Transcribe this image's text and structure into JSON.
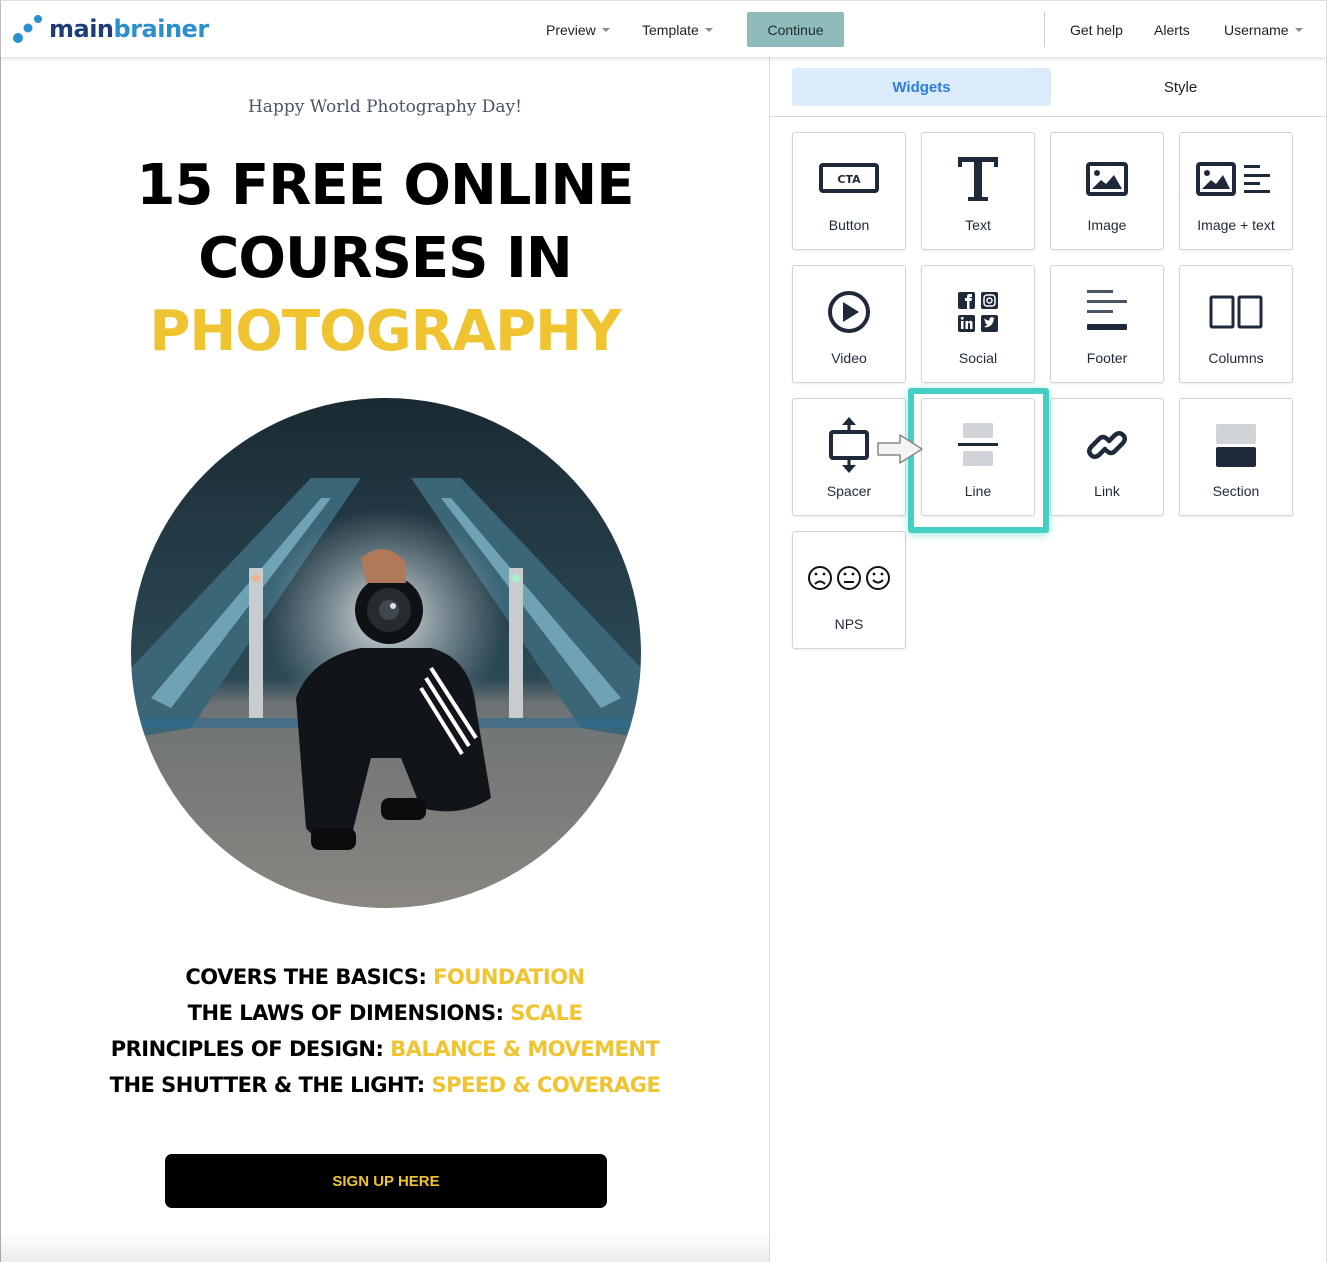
{
  "header": {
    "logo": {
      "part1": "main",
      "part2": "brainer"
    },
    "nav": {
      "preview": "Preview",
      "template": "Template",
      "continue": "Continue",
      "get_help": "Get help",
      "alerts": "Alerts",
      "username": "Username"
    }
  },
  "email": {
    "subtitle": "Happy World Photography Day!",
    "headline": {
      "line1": "15 FREE ONLINE",
      "line2": "COURSES IN",
      "line3": "PHOTOGRAPHY"
    },
    "hero_image_alt": "Photographer crouching between escalators holding camera in smoke",
    "topics": [
      {
        "label": "COVERS THE BASICS:",
        "value": "FOUNDATION"
      },
      {
        "label": "THE LAWS OF DIMENSIONS:",
        "value": "SCALE"
      },
      {
        "label": "PRINCIPLES OF DESIGN:",
        "value": "BALANCE & MOVEMENT"
      },
      {
        "label": "THE SHUTTER & THE LIGHT:",
        "value": "SPEED & COVERAGE"
      }
    ],
    "cta": "SIGN UP HERE",
    "accent_color": "#f0c330"
  },
  "panel": {
    "tabs": [
      {
        "label": "Widgets",
        "active": true
      },
      {
        "label": "Style",
        "active": false
      }
    ],
    "widgets": [
      {
        "label": "Button",
        "icon": "cta-button-icon",
        "icon_text": "CTA"
      },
      {
        "label": "Text",
        "icon": "text-icon"
      },
      {
        "label": "Image",
        "icon": "image-icon"
      },
      {
        "label": "Image + text",
        "icon": "image-text-icon"
      },
      {
        "label": "Video",
        "icon": "play-icon"
      },
      {
        "label": "Social",
        "icon": "social-icon"
      },
      {
        "label": "Footer",
        "icon": "footer-icon"
      },
      {
        "label": "Columns",
        "icon": "columns-icon"
      },
      {
        "label": "Spacer",
        "icon": "spacer-icon"
      },
      {
        "label": "Line",
        "icon": "line-icon",
        "highlighted": true
      },
      {
        "label": "Link",
        "icon": "link-icon"
      },
      {
        "label": "Section",
        "icon": "section-icon"
      },
      {
        "label": "NPS",
        "icon": "nps-icon"
      }
    ],
    "highlight_color": "#45cfc2"
  }
}
